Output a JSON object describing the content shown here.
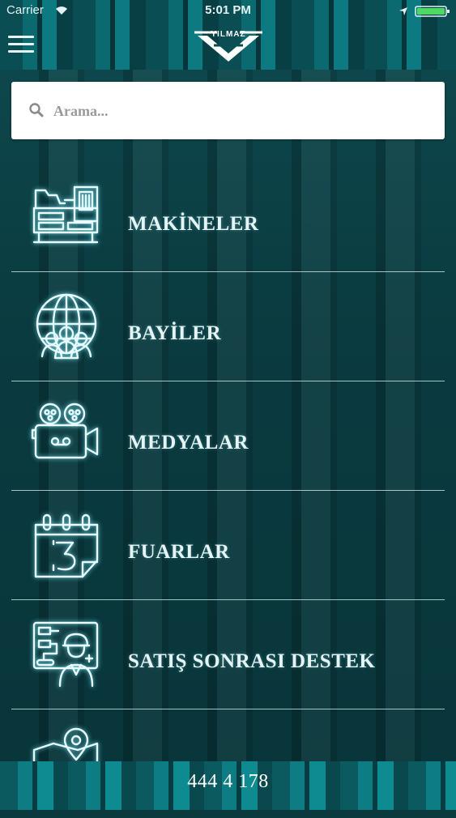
{
  "status_bar": {
    "carrier": "Carrier",
    "time": "5:01 PM",
    "icons": [
      "wifi-icon",
      "location-icon",
      "battery-icon"
    ]
  },
  "header": {
    "logo_text": "YILMAZ",
    "menu_icon": "hamburger-icon"
  },
  "search": {
    "placeholder": "Arama...",
    "value": "",
    "icon": "search-icon"
  },
  "menu": {
    "items": [
      {
        "label": "MAKİNELER",
        "icon": "machine-icon"
      },
      {
        "label": "BAYİLER",
        "icon": "globe-people-icon"
      },
      {
        "label": "MEDYALAR",
        "icon": "video-camera-icon"
      },
      {
        "label": "FUARLAR",
        "icon": "calendar-icon"
      },
      {
        "label": "SATIŞ SONRASI DESTEK",
        "icon": "support-worker-icon"
      },
      {
        "label": "",
        "icon": "map-pin-icon"
      }
    ]
  },
  "footer": {
    "phone": "444 4 178"
  },
  "colors": {
    "background": "#0b3a3e",
    "accent": "#0c7a80",
    "label": "#e6f4f6",
    "search_bg": "#ffffff"
  }
}
